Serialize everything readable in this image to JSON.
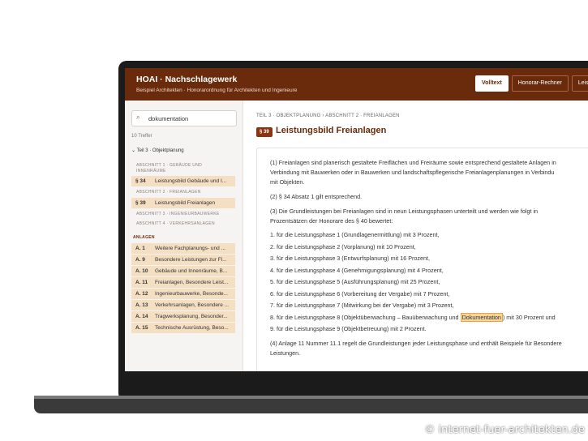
{
  "header": {
    "title": "HOAI · Nachschlagewerk",
    "subtitle": "Beispiel Architekten · Honorarordnung für Architekten und Ingenieure",
    "tabs": [
      "Volltext",
      "Honorar-Rechner",
      "Leist"
    ]
  },
  "sidebar": {
    "search_value": "dokumentation",
    "hits": "10 Treffer",
    "part": "Teil 3 · Objektplanung",
    "sections": [
      "ABSCHNITT 1 · GEBÄUDE UND INNENRÄUME",
      "ABSCHNITT 2 · FREIANLAGEN",
      "ABSCHNITT 3 · INGENIEURBAUWERKE",
      "ABSCHNITT 4 · VERKEHRSANLAGEN"
    ],
    "items_main": [
      {
        "num": "§ 34",
        "label": "Leistungsbild Gebäude und I..."
      },
      {
        "num": "§ 39",
        "label": "Leistungsbild Freianlagen"
      }
    ],
    "anlagen_label": "ANLAGEN",
    "anlagen": [
      {
        "num": "A. 1",
        "label": "Weitere Fachplanungs- und ..."
      },
      {
        "num": "A. 9",
        "label": "Besondere Leistungen zur Fl..."
      },
      {
        "num": "A. 10",
        "label": "Gebäude und Innenräume, B..."
      },
      {
        "num": "A. 11",
        "label": "Freianlagen, Besondere Leist..."
      },
      {
        "num": "A. 12",
        "label": "Ingenieurbauwerke, Besonde..."
      },
      {
        "num": "A. 13",
        "label": "Verkehrsanlagen, Besondere ..."
      },
      {
        "num": "A. 14",
        "label": "Tragwerksplanung, Besonder..."
      },
      {
        "num": "A. 15",
        "label": "Technische Ausrüstung, Beso..."
      }
    ]
  },
  "main": {
    "breadcrumb": "TEIL 3 · OBJEKTPLANUNG › ABSCHNITT 2 · FREIANLAGEN",
    "badge": "§ 39",
    "title": "Leistungsbild Freianlagen",
    "p1_lines": [
      "(1) Freianlagen sind planerisch gestaltete Freiflächen und Freiräume sowie entsprechend gestaltete Anlagen in",
      "Verbindung mit Bauwerken oder in Bauwerken und landschaftspflegerische Freianlagenplanungen in Verbindu",
      "mit Objekten."
    ],
    "p2": "(2) § 34 Absatz 1 gilt entsprechend.",
    "p3_lines": [
      "(3) Die Grundleistungen bei Freianlagen sind in neun Leistungsphasen unterteilt und werden wie folgt in",
      "Prozentsätzen der Honorare des § 40 bewertet:"
    ],
    "phases": [
      "1.  für die Leistungsphase 1 (Grundlagenermittlung) mit 3 Prozent,",
      "2.  für die Leistungsphase 2 (Vorplanung) mit 10 Prozent,",
      "3.  für die Leistungsphase 3 (Entwurfsplanung) mit 16 Prozent,",
      "4.  für die Leistungsphase 4 (Genehmigungsplanung) mit 4 Prozent,",
      "5.  für die Leistungsphase 5 (Ausführungsplanung) mit 25 Prozent,",
      "6.  für die Leistungsphase 6 (Vorbereitung der Vergabe) mit 7 Prozent,",
      "7.  für die Leistungsphase 7 (Mitwirkung bei der Vergabe) mit 3 Prozent,"
    ],
    "phase8_pre": "8.  für die Leistungsphase 8 (Objektüberwachung – Bauüberwachung und ",
    "phase8_hl": "Dokumentation",
    "phase8_post": ") mit 30 Prozent und",
    "phase9": "9.  für die Leistungsphase 9 (Objektbetreuung) mit 2 Prozent.",
    "p4_lines": [
      "(4) Anlage 11 Nummer 11.1 regelt die Grundleistungen jeder Leistungsphase und enthält Beispiele für Besondere",
      "Leistungen."
    ]
  },
  "watermark": "© internet-fuer-architekten.de"
}
